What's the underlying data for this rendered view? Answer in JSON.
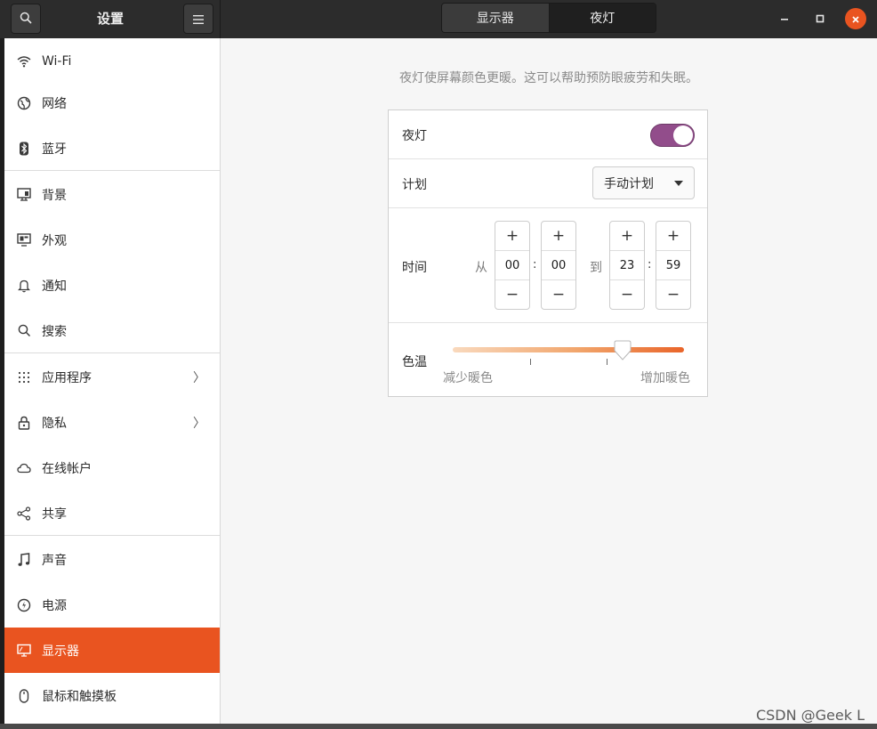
{
  "header": {
    "title": "设置",
    "search_icon": "search-icon",
    "menu_icon": "hamburger-menu-icon",
    "tabs": [
      {
        "label": "显示器",
        "active": false
      },
      {
        "label": "夜灯",
        "active": true
      }
    ],
    "controls": [
      "minimize-icon",
      "maximize-icon",
      "close-icon"
    ]
  },
  "sidebar": {
    "items": [
      {
        "label": "Wi-Fi",
        "icon": "wifi-icon"
      },
      {
        "label": "网络",
        "icon": "globe-icon"
      },
      {
        "label": "蓝牙",
        "icon": "bluetooth-icon"
      },
      {
        "label": "背景",
        "icon": "monitor-background-icon"
      },
      {
        "label": "外观",
        "icon": "appearance-icon"
      },
      {
        "label": "通知",
        "icon": "bell-icon"
      },
      {
        "label": "搜索",
        "icon": "search-icon"
      },
      {
        "label": "应用程序",
        "icon": "grid-icon",
        "chevron": "〉"
      },
      {
        "label": "隐私",
        "icon": "lock-icon",
        "chevron": "〉"
      },
      {
        "label": "在线帐户",
        "icon": "cloud-icon"
      },
      {
        "label": "共享",
        "icon": "share-icon"
      },
      {
        "label": "声音",
        "icon": "music-note-icon"
      },
      {
        "label": "电源",
        "icon": "power-icon"
      },
      {
        "label": "显示器",
        "icon": "display-icon",
        "active": true
      },
      {
        "label": "鼠标和触摸板",
        "icon": "mouse-icon"
      }
    ]
  },
  "main": {
    "description": "夜灯使屏幕颜色更暖。这可以帮助预防眼疲劳和失眠。",
    "night_light": {
      "label": "夜灯",
      "enabled": true
    },
    "schedule": {
      "label": "计划",
      "value": "手动计划"
    },
    "time": {
      "label": "时间",
      "from_label": "从",
      "to_label": "到",
      "from_hour": "00",
      "from_minute": "00",
      "to_hour": "23",
      "to_minute": "59",
      "colon": ":",
      "plus": "+",
      "minus": "−"
    },
    "color_temp": {
      "label": "色温",
      "min_label": "减少暖色",
      "max_label": "增加暖色",
      "level": 0.74
    }
  },
  "watermark": "CSDN @Geek L",
  "colors": {
    "accent": "#e95420",
    "toggle_on": "#924d8b"
  }
}
